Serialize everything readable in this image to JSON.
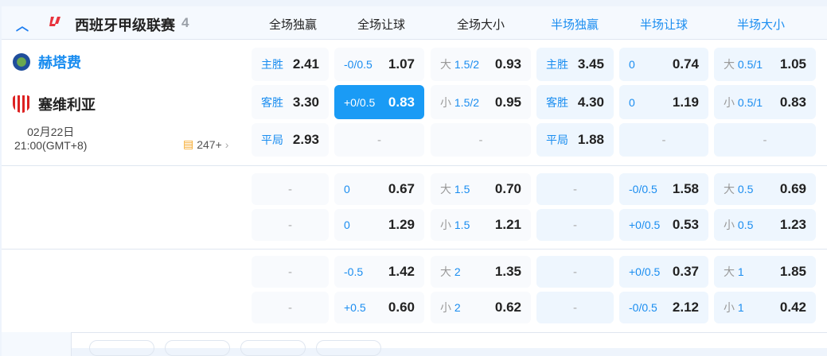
{
  "league": {
    "name": "西班牙甲级联赛",
    "count": "4"
  },
  "columns": [
    {
      "label": "全场独赢",
      "color": "#222222"
    },
    {
      "label": "全场让球",
      "color": "#222222"
    },
    {
      "label": "全场大小",
      "color": "#222222"
    },
    {
      "label": "半场独赢",
      "color": "#1a8df0"
    },
    {
      "label": "半场让球",
      "color": "#1a8df0"
    },
    {
      "label": "半场大小",
      "color": "#1a8df0"
    }
  ],
  "match": {
    "home": "赫塔费",
    "away": "塞维利亚",
    "date": "02月22日",
    "time": "21:00(GMT+8)",
    "more": "247+"
  },
  "rows": [
    [
      {
        "p": "主胜",
        "o": "2.41"
      },
      {
        "p": "-0/0.5",
        "o": "1.07"
      },
      {
        "g": "大",
        "p": "1.5/2",
        "o": "0.93"
      },
      {
        "p": "主胜",
        "o": "3.45"
      },
      {
        "p": "0",
        "o": "0.74"
      },
      {
        "g": "大",
        "p": "0.5/1",
        "o": "1.05"
      }
    ],
    [
      {
        "p": "客胜",
        "o": "3.30"
      },
      {
        "p": "+0/0.5",
        "o": "0.83",
        "selected": true
      },
      {
        "g": "小",
        "p": "1.5/2",
        "o": "0.95"
      },
      {
        "p": "客胜",
        "o": "4.30"
      },
      {
        "p": "0",
        "o": "1.19"
      },
      {
        "g": "小",
        "p": "0.5/1",
        "o": "0.83"
      }
    ],
    [
      {
        "p": "平局",
        "o": "2.93"
      },
      {
        "dash": "-"
      },
      {
        "dash": "-"
      },
      {
        "p": "平局",
        "o": "1.88"
      },
      {
        "dash": "-"
      },
      {
        "dash": "-"
      }
    ],
    [
      {
        "dash": "-"
      },
      {
        "p": "0",
        "o": "0.67"
      },
      {
        "g": "大",
        "p": "1.5",
        "o": "0.70"
      },
      {
        "dash": "-"
      },
      {
        "p": "-0/0.5",
        "o": "1.58"
      },
      {
        "g": "大",
        "p": "0.5",
        "o": "0.69"
      }
    ],
    [
      {
        "dash": "-"
      },
      {
        "p": "0",
        "o": "1.29"
      },
      {
        "g": "小",
        "p": "1.5",
        "o": "1.21"
      },
      {
        "dash": "-"
      },
      {
        "p": "+0/0.5",
        "o": "0.53"
      },
      {
        "g": "小",
        "p": "0.5",
        "o": "1.23"
      }
    ],
    [
      {
        "dash": "-"
      },
      {
        "p": "-0.5",
        "o": "1.42"
      },
      {
        "g": "大",
        "p": "2",
        "o": "1.35"
      },
      {
        "dash": "-"
      },
      {
        "p": "+0/0.5",
        "o": "0.37"
      },
      {
        "g": "大",
        "p": "1",
        "o": "1.85"
      }
    ],
    [
      {
        "dash": "-"
      },
      {
        "p": "+0.5",
        "o": "0.60"
      },
      {
        "g": "小",
        "p": "2",
        "o": "0.62"
      },
      {
        "dash": "-"
      },
      {
        "p": "-0/0.5",
        "o": "2.12"
      },
      {
        "g": "小",
        "p": "1",
        "o": "0.42"
      }
    ]
  ]
}
